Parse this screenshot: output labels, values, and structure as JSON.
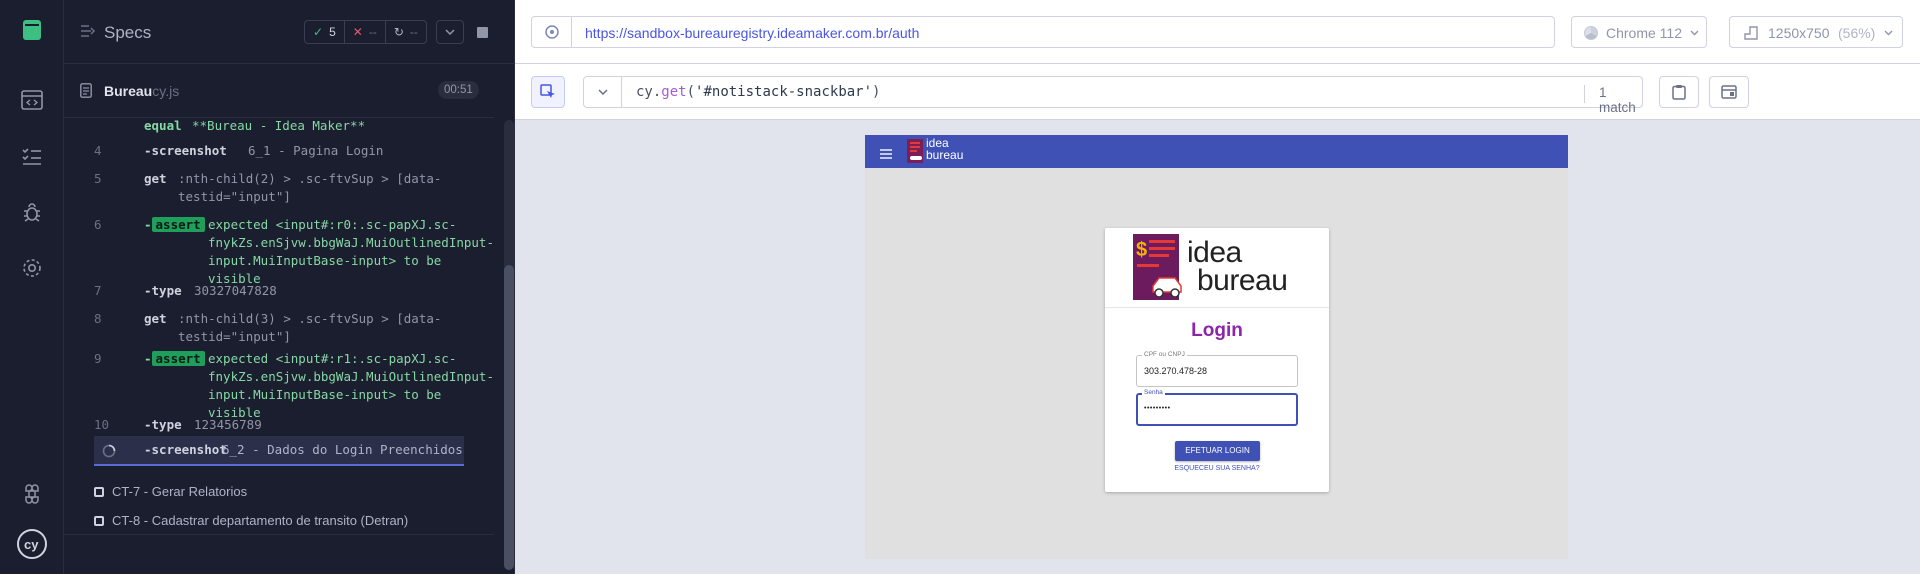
{
  "specs_header": {
    "title": "Specs",
    "passed": "5",
    "failed": "--",
    "pending": "--"
  },
  "spec_file": {
    "name": "Bureau",
    "ext": "cy.js",
    "duration": "00:51"
  },
  "commands": [
    {
      "num": "",
      "name": "equal",
      "msg": "**Bureau - Idea Maker**"
    },
    {
      "num": "4",
      "name": "-screenshot",
      "msg": "6_1 - Pagina Login"
    },
    {
      "num": "5",
      "name": "get",
      "msg": ":nth-child(2) > .sc-ftvSup > [data-testid=\"input\"]"
    },
    {
      "num": "6",
      "name": "-assert",
      "msg": "expected <input#:r0:.sc-papXJ.sc-fnykZs.enSjvw.bbgWaJ.MuiOutlinedInput-input.MuiInputBase-input> to be visible"
    },
    {
      "num": "7",
      "name": "-type",
      "msg": "30327047828"
    },
    {
      "num": "8",
      "name": "get",
      "msg": ":nth-child(3) > .sc-ftvSup > [data-testid=\"input\"]"
    },
    {
      "num": "9",
      "name": "-assert",
      "msg": "expected <input#:r1:.sc-papXJ.sc-fnykZs.enSjvw.bbgWaJ.MuiOutlinedInput-input.MuiInputBase-input> to be visible"
    },
    {
      "num": "10",
      "name": "-type",
      "msg": "123456789"
    },
    {
      "num": "",
      "name": "-screenshot",
      "msg": "6_2 - Dados do Login Preenchidos"
    }
  ],
  "tests": [
    {
      "label": "CT-7 - Gerar Relatorios"
    },
    {
      "label": "CT-8 - Cadastrar departamento de transito (Detran)"
    }
  ],
  "aut": {
    "url": "https://sandbox-bureauregistry.ideamaker.com.br/auth",
    "browser": "Chrome 112",
    "viewport": "1250x750",
    "viewport_scale": "(56%)",
    "selector_prefix": "cy",
    "selector_method": "get",
    "selector_value": "'#notistack-snackbar'",
    "match_count": "1 match"
  },
  "app": {
    "logo_line1": "idea",
    "logo_line2": "bureau",
    "login_title": "Login",
    "cpf_label": "CPF ou CNPJ",
    "cpf_value": "303.270.478-28",
    "senha_label": "Senha",
    "senha_value": "•••••••••",
    "submit_label": "EFETUAR LOGIN",
    "forgot_label": "ESQUECEU SUA SENHA?"
  },
  "colors": {
    "accent_green": "#1f9e5c",
    "app_bar": "#3f51b5",
    "login_purple": "#8e24aa"
  }
}
